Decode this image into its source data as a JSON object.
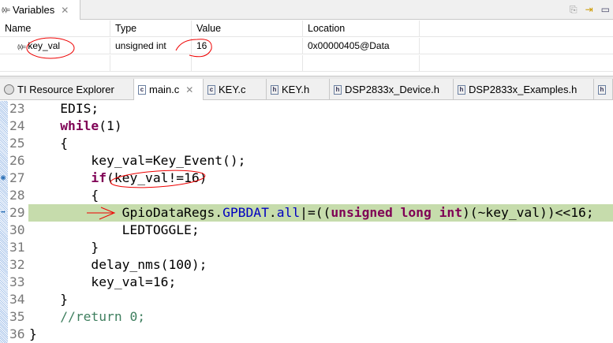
{
  "variables_view": {
    "title": "Variables",
    "columns": [
      "Name",
      "Type",
      "Value",
      "Location"
    ],
    "rows": [
      {
        "name": "key_val",
        "type": "unsigned int",
        "value": "16",
        "location": "0x00000405@Data"
      }
    ]
  },
  "editor_tabs": [
    "TI Resource Explorer",
    "main.c",
    "KEY.c",
    "KEY.h",
    "DSP2833x_Device.h",
    "DSP2833x_Examples.h"
  ],
  "code": {
    "line_numbers": [
      "23",
      "24",
      "25",
      "26",
      "27",
      "28",
      "29",
      "30",
      "31",
      "32",
      "33",
      "34",
      "35",
      "36"
    ],
    "l23": "    EDIS;",
    "l24_kw": "while",
    "l24_rest": "(1)",
    "l25": "    {",
    "l26": "        key_val=Key_Event();",
    "l27_kw": "if",
    "l27_rest": "(key_val!=16)",
    "l28": "        {",
    "l29_a": "GpioDataRegs.",
    "l29_b": "GPBDAT",
    "l29_c": ".",
    "l29_d": "all",
    "l29_e": "|=((",
    "l29_f": "unsigned long int",
    "l29_g": ")(~key_val))<<16;",
    "l30": "            LEDTOGGLE;",
    "l31": "        }",
    "l32": "        delay_nms(100);",
    "l33": "        key_val=16;",
    "l34": "    }",
    "l35": "//return 0;",
    "l36": "}"
  },
  "active_line": "29"
}
